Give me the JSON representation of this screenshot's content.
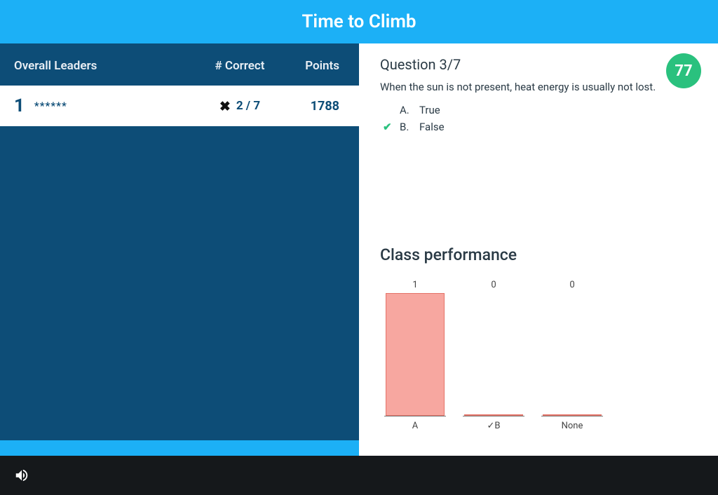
{
  "header": {
    "title": "Time to Climb"
  },
  "leaderboard": {
    "columns": {
      "name": "Overall Leaders",
      "correct": "# Correct",
      "points": "Points"
    },
    "rows": [
      {
        "rank": "1",
        "name": "******",
        "correct": "2 / 7",
        "points": "1788",
        "status": "incorrect"
      }
    ]
  },
  "question": {
    "label": "Question 3/7",
    "text": "When the sun is not present, heat energy is usually not lost.",
    "options": [
      {
        "letter": "A.",
        "text": "True",
        "correct": false
      },
      {
        "letter": "B.",
        "text": "False",
        "correct": true
      }
    ],
    "score": "77"
  },
  "performance": {
    "title": "Class performance"
  },
  "chart_data": {
    "type": "bar",
    "categories": [
      "A",
      "✓B",
      "None"
    ],
    "values": [
      1,
      0,
      0
    ],
    "title": "Class performance",
    "xlabel": "",
    "ylabel": "",
    "ylim": [
      0,
      1
    ]
  },
  "progress": {
    "percent": 100
  }
}
